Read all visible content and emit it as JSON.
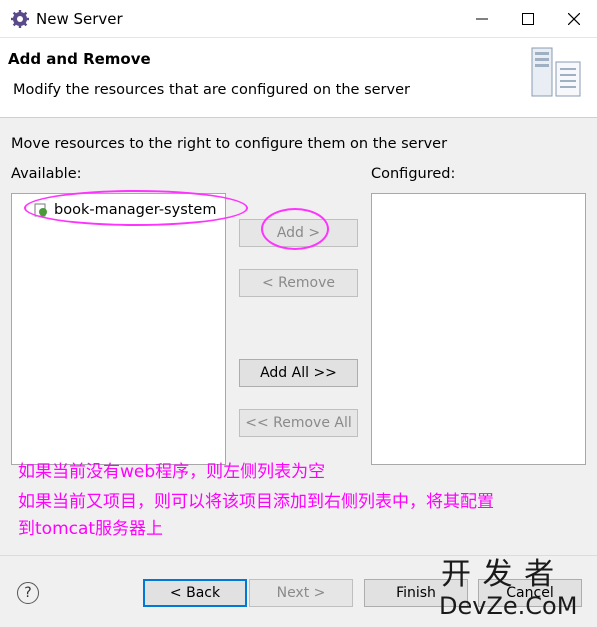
{
  "window": {
    "title": "New Server"
  },
  "header": {
    "title": "Add and Remove",
    "description": "Modify the resources that are configured on the server"
  },
  "main": {
    "instruction": "Move resources to the right to configure them on the server",
    "available_label": "Available:",
    "configured_label": "Configured:",
    "available_items": [
      "book-manager-system"
    ]
  },
  "buttons": {
    "add": "Add >",
    "remove": "< Remove",
    "add_all": "Add All >>",
    "remove_all": "<< Remove All"
  },
  "annotations": [
    "如果当前没有web程序，则左侧列表为空",
    "如果当前又项目，则可以将该项目添加到右侧列表中，将其配置",
    "到tomcat服务器上"
  ],
  "footer": {
    "help": "?",
    "back": "< Back",
    "next": "Next >",
    "finish": "Finish",
    "cancel": "Cancel"
  },
  "watermark": {
    "top": "开 发 者",
    "bottom": "DevZe.CoM"
  },
  "colors": {
    "annotation": "#ff00ff",
    "focus": "#0078d7"
  }
}
